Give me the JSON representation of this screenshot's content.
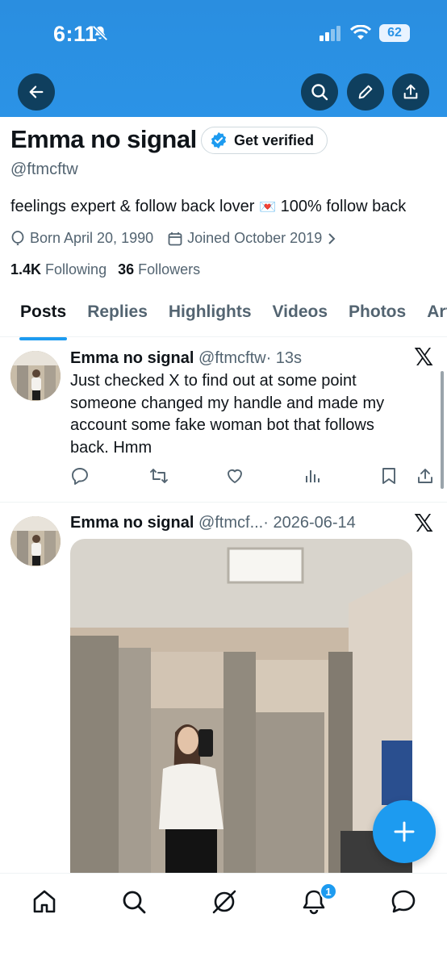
{
  "status_bar": {
    "time": "6:11",
    "battery": "62"
  },
  "profile": {
    "name": "Emma no signal",
    "verify_label": "Get verified",
    "handle": "@ftmcftw",
    "bio_before": "feelings expert & follow back lover ",
    "bio_emoji": "💌",
    "bio_after": " 100% follow back",
    "born": "Born April 20, 1990",
    "joined": "Joined October 2019",
    "following_count": "1.4K",
    "following_label": "Following",
    "followers_count": "36",
    "followers_label": "Followers"
  },
  "tabs": [
    {
      "label": "Posts",
      "active": true
    },
    {
      "label": "Replies"
    },
    {
      "label": "Highlights"
    },
    {
      "label": "Videos"
    },
    {
      "label": "Photos"
    },
    {
      "label": "Art"
    }
  ],
  "posts": [
    {
      "name": "Emma no signal",
      "handle": "@ftmcftw",
      "time": "· 13s",
      "text": "Just checked X to find out at some point someone changed my handle and made my account some fake woman bot that follows back. Hmm"
    },
    {
      "name": "Emma no signal",
      "handle": "@ftmcf...",
      "time": "· 2026-06-14"
    }
  ],
  "nav": {
    "notifications_badge": "1"
  },
  "colors": {
    "accent": "#1d9bf0",
    "header": "#2b93e6",
    "header_button": "#0f3f5e"
  }
}
